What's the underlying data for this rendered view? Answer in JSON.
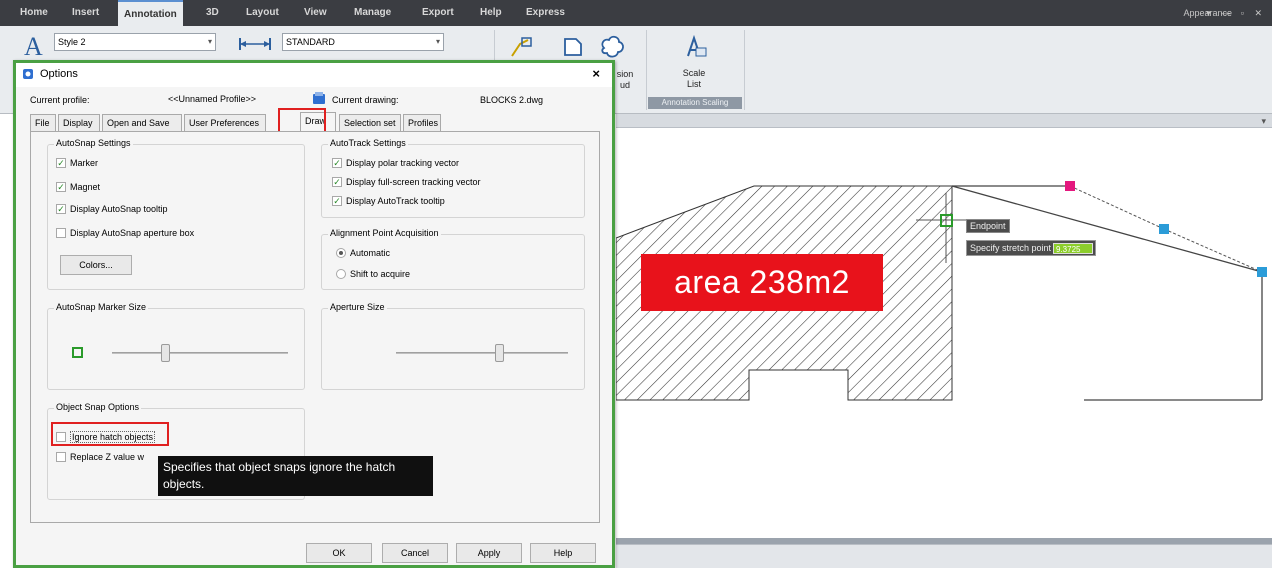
{
  "menu": {
    "tabs": [
      "Home",
      "Insert",
      "Annotation",
      "3D",
      "Layout",
      "View",
      "Manage",
      "Export",
      "Help",
      "Express"
    ],
    "active_tab": "Annotation",
    "appearance": "Appearance"
  },
  "ribbon": {
    "text_style": "Style 2",
    "dim_style": "STANDARD",
    "revision_cloud_label_part": "sion\nud",
    "scale_list_label": "Scale\nList",
    "panel_title": "Annotation Scaling"
  },
  "dialog": {
    "title": "Options",
    "current_profile_label": "Current profile:",
    "current_profile_value": "<<Unnamed Profile>>",
    "current_drawing_label": "Current drawing:",
    "current_drawing_value": "BLOCKS 2.dwg",
    "tabs": [
      "File",
      "Display",
      "Open and Save",
      "User Preferences",
      "Draw",
      "Selection set",
      "Profiles"
    ],
    "active_tab": "Draw",
    "autosnap": {
      "title": "AutoSnap Settings",
      "marker": "Marker",
      "magnet": "Magnet",
      "tooltip": "Display AutoSnap tooltip",
      "aperture_box": "Display AutoSnap aperture box",
      "colors_button": "Colors..."
    },
    "autotrack": {
      "title": "AutoTrack Settings",
      "polar": "Display polar tracking vector",
      "fullscreen": "Display full-screen tracking vector",
      "tooltip": "Display AutoTrack tooltip"
    },
    "alignment": {
      "title": "Alignment Point Acquisition",
      "automatic": "Automatic",
      "shift": "Shift to acquire"
    },
    "marker_size_title": "AutoSnap Marker Size",
    "aperture_size_title": "Aperture Size",
    "marker_size_level": 0.3,
    "aperture_size_level": 0.6,
    "object_snap": {
      "title": "Object Snap Options",
      "ignore_hatch": "Ignore hatch objects",
      "replace_z": "Replace Z value w"
    },
    "tooltip_text": "Specifies that object snaps ignore the hatch objects.",
    "buttons": {
      "ok": "OK",
      "cancel": "Cancel",
      "apply": "Apply",
      "help": "Help"
    }
  },
  "drawing": {
    "area_label": "area 238m2",
    "endpoint_tip": "Endpoint",
    "stretch_prompt": "Specify stretch point or",
    "stretch_value": "9.3725",
    "colors": {
      "hatch": "#333333",
      "grip_pink": "#e4187e",
      "grip_blue": "#2b9cd8",
      "snap_green": "#2a9a2a",
      "label_bg": "#e8121b"
    }
  }
}
